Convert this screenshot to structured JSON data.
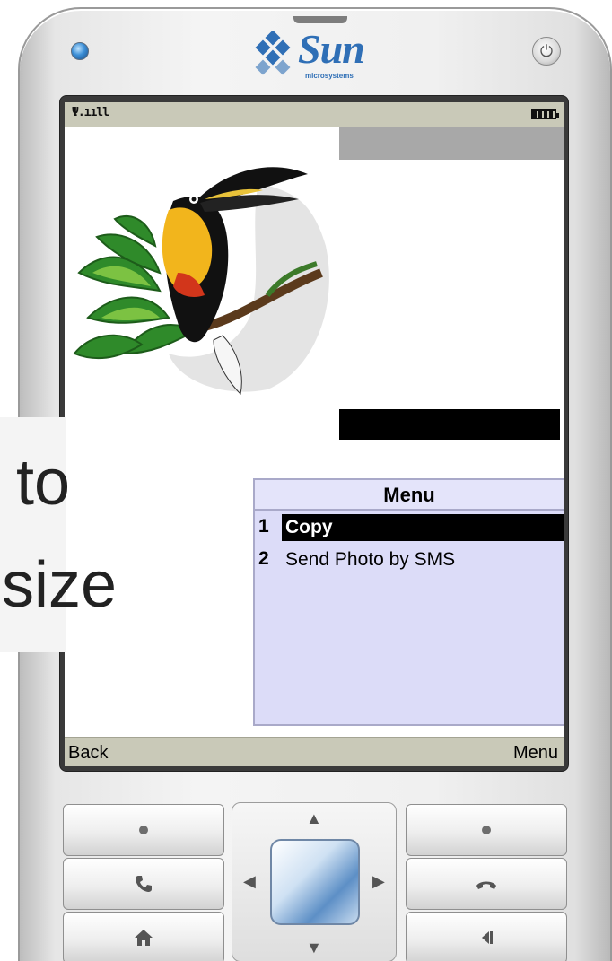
{
  "device": {
    "brand": "Sun",
    "brand_sub": "microsystems"
  },
  "status_bar": {
    "signal_text": "Ψ.ııll",
    "battery_icon": "battery-icon"
  },
  "menu": {
    "title": "Menu",
    "items": [
      {
        "number": "1",
        "label": "Copy",
        "selected": true
      },
      {
        "number": "2",
        "label": "Send Photo by SMS",
        "selected": false
      }
    ]
  },
  "softkeys": {
    "left": "Back",
    "right": "Menu"
  },
  "overlay": {
    "line1": "e to",
    "line2": "n size"
  },
  "colors": {
    "menu_bg": "#dcdcf8",
    "softkey_bg": "#c9c9b8",
    "logo_blue": "#2f6fb6"
  }
}
